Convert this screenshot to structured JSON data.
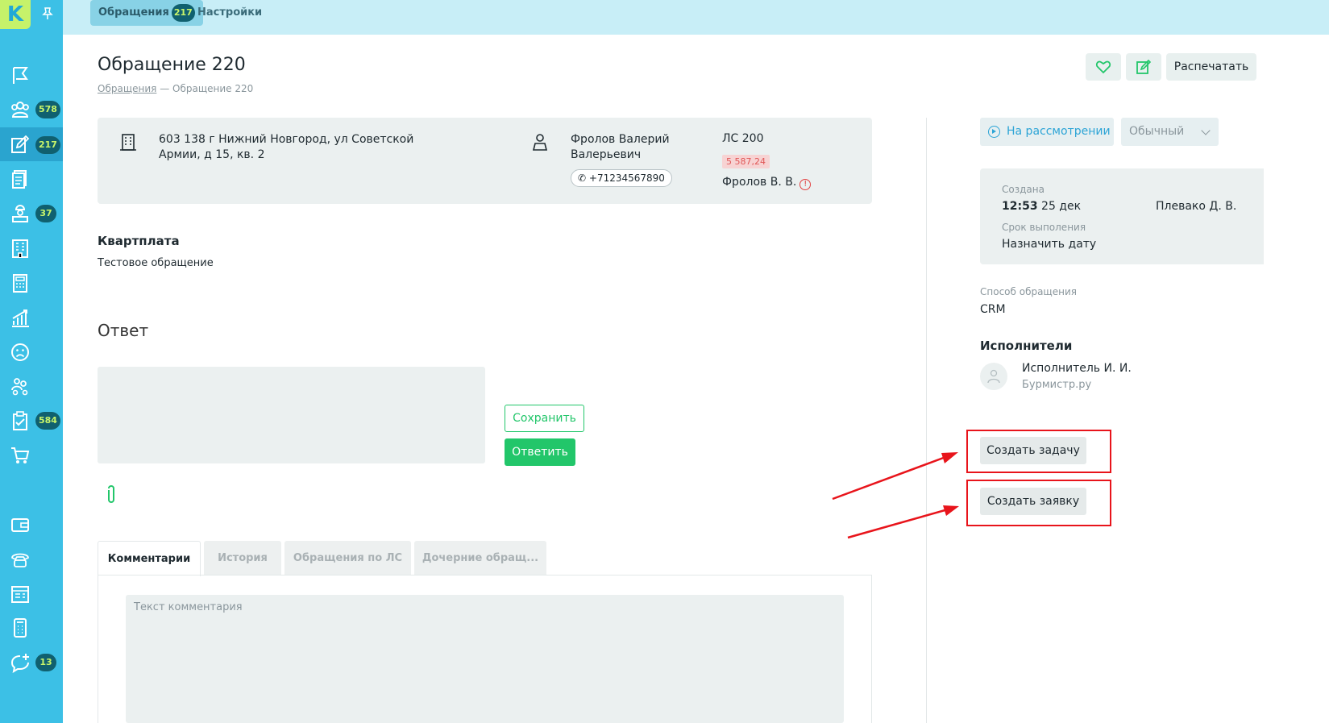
{
  "logo": {
    "letter": "K"
  },
  "nav": {
    "badges": {
      "residents": "578",
      "requests": "217",
      "inspectors": "37",
      "tasks": "584",
      "chat": "13"
    }
  },
  "topbar": {
    "tabs": [
      {
        "label": "Обращения",
        "count": "217"
      },
      {
        "label": "Настройки"
      }
    ]
  },
  "page": {
    "title": "Обращение 220",
    "breadcrumb": {
      "parent": "Обращения",
      "separator": "—",
      "current": "Обращение 220"
    },
    "print_label": "Распечатать"
  },
  "info": {
    "address": "603 138 г Нижний Новгород, ул Советской Армии, д 15, кв. 2",
    "owner": "Фролов Валерий Валерьевич",
    "phone": "+71234567890",
    "account": "ЛС 200",
    "debt": "5 587,24",
    "person": "Фролов В. В.",
    "warning_mark": "!"
  },
  "request": {
    "category": "Квартплата",
    "description": "Тестовое обращение"
  },
  "answer": {
    "title": "Ответ",
    "save_label": "Сохранить",
    "reply_label": "Ответить"
  },
  "tabs": [
    {
      "label": "Комментарии",
      "active": true
    },
    {
      "label": "История"
    },
    {
      "label": "Обращения по ЛС"
    },
    {
      "label": "Дочерние обращ..."
    }
  ],
  "comment": {
    "placeholder": "Текст комментария"
  },
  "sidebar_right": {
    "status": "На рассмотрении",
    "priority": "Обычный",
    "created_label": "Создана",
    "created_time": "12:53",
    "created_date": "25 дек",
    "created_by": "Плевако Д. В.",
    "deadline_label": "Срок выполения",
    "deadline_value": "Назначить дату",
    "channel_label": "Способ обращения",
    "channel_value": "CRM",
    "executors_title": "Исполнители",
    "executor_name": "Исполнитель И. И.",
    "executor_org": "Бурмистр.ру",
    "create_task_label": "Создать задачу",
    "create_request_label": "Создать заявку"
  },
  "colors": {
    "sidebar": "#3cc0e6",
    "accent_green": "#22c66a",
    "link_blue": "#2ca4d6",
    "highlight_red": "#e8141b",
    "badge_bg": "#10606f",
    "badge_text": "#c9f56a"
  }
}
